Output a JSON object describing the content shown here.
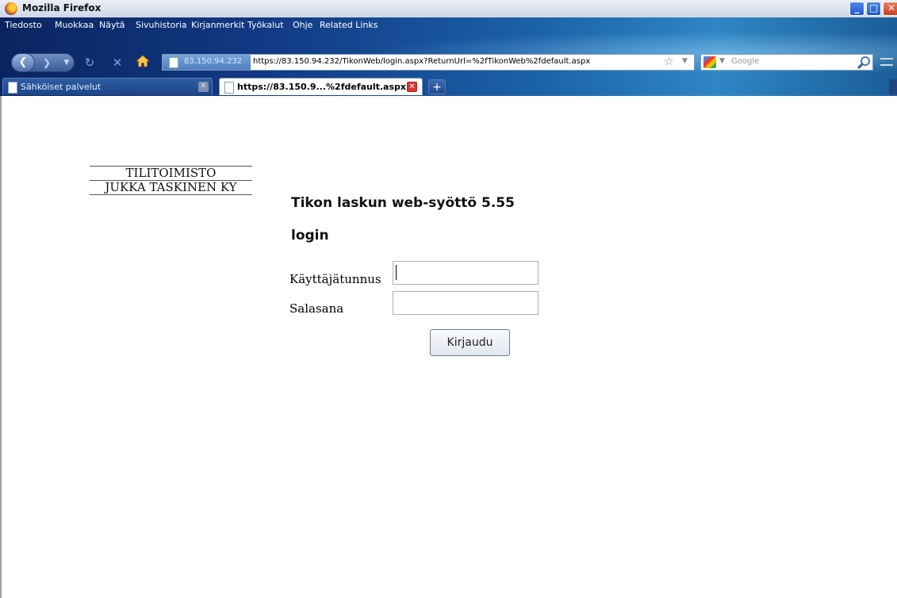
{
  "window": {
    "title": "Mozilla Firefox"
  },
  "menu": [
    "Tiedosto",
    "Muokkaa",
    "Näytä",
    "Sivuhistoria",
    "Kirjanmerkit",
    "Työkalut",
    "Ohje",
    "Related Links"
  ],
  "urlbar": {
    "site": "83.150.94.232",
    "url": "https://83.150.94.232/TikonWeb/login.aspx?ReturnUrl=%2fTikonWeb%2fdefault.aspx"
  },
  "search": {
    "placeholder": "Google"
  },
  "tabs": [
    {
      "label": "Sähköiset palvelut",
      "active": false
    },
    {
      "label": "https://83.150.9...%2fdefault.aspx",
      "active": true
    }
  ],
  "page": {
    "logo_line1": "TILITOIMISTO",
    "logo_line2": "JUKKA TASKINEN KY",
    "heading": "Tikon laskun web-syöttö 5.55",
    "subheading": "login",
    "username_label": "Käyttäjätunnus",
    "username_value": "",
    "password_label": "Salasana",
    "password_value": "",
    "login_button": "Kirjaudu"
  },
  "colors": {
    "chrome_dark": "#0a2460",
    "chrome_light": "#2f86c4",
    "close_red": "#c5401f"
  }
}
